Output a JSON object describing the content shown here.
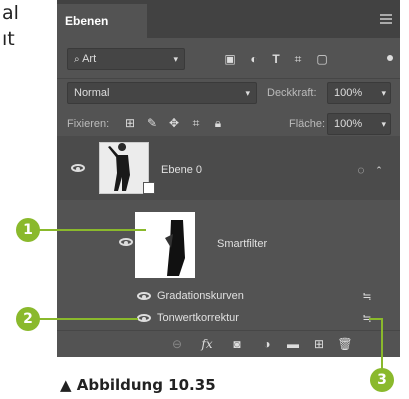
{
  "side_text": {
    "line1": "al",
    "line2": "ıt"
  },
  "panel": {
    "tab_title": "Ebenen",
    "filter": {
      "kind_label": "Art",
      "icons": [
        "image-filter",
        "adjustment-filter",
        "T",
        "shape-filter",
        "smartobject-filter"
      ]
    },
    "blend_mode": "Normal",
    "opacity_label": "Deckkraft:",
    "opacity_value": "100%",
    "lock_label": "Fixieren:",
    "fill_label": "Fläche:",
    "fill_value": "100%",
    "layers": {
      "layer0_name": "Ebene 0",
      "smartfilter_label": "Smartfilter",
      "filter1": "Gradationskurven",
      "filter2": "Tonwertkorrektur"
    },
    "bottom_toolbar": [
      "link",
      "fx",
      "mask",
      "adjustment",
      "group",
      "new-layer",
      "trash"
    ]
  },
  "callouts": [
    "1",
    "2",
    "3"
  ],
  "caption": "▲ Abbildung 10.35"
}
